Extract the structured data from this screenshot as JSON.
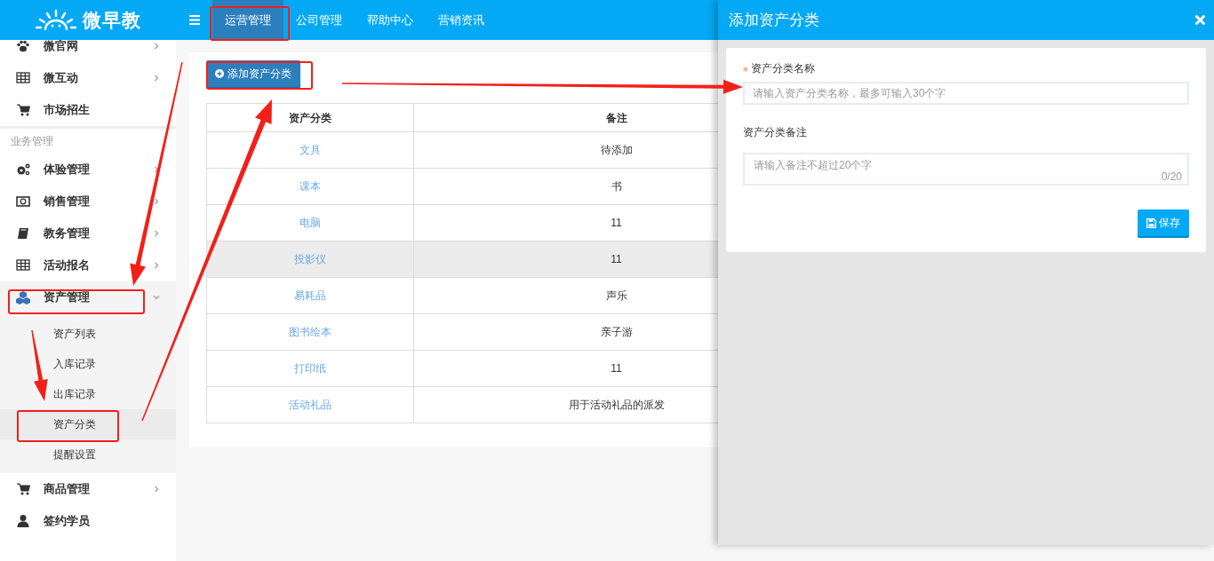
{
  "logo": {
    "text": "微早教"
  },
  "top_nav": [
    {
      "label": "运营管理",
      "selected": true
    },
    {
      "label": "公司管理",
      "selected": false
    },
    {
      "label": "帮助中心",
      "selected": false
    },
    {
      "label": "营销资讯",
      "selected": false
    }
  ],
  "sidebar": {
    "items": [
      {
        "kind": "item",
        "label": "微官网",
        "expanded": false
      },
      {
        "kind": "item",
        "label": "微互动",
        "expanded": false
      },
      {
        "kind": "item",
        "label": "市场招生"
      },
      {
        "kind": "heading",
        "label": "业务管理"
      },
      {
        "kind": "item",
        "label": "体验管理",
        "expanded": false
      },
      {
        "kind": "item",
        "label": "销售管理",
        "expanded": false
      },
      {
        "kind": "item",
        "label": "教务管理",
        "expanded": false
      },
      {
        "kind": "item",
        "label": "活动报名",
        "expanded": false
      },
      {
        "kind": "item",
        "label": "资产管理",
        "expanded": true,
        "children": [
          {
            "label": "资产列表",
            "selected": false
          },
          {
            "label": "入库记录",
            "selected": false
          },
          {
            "label": "出库记录",
            "selected": false
          },
          {
            "label": "资产分类",
            "selected": true
          },
          {
            "label": "提醒设置",
            "selected": false
          }
        ]
      },
      {
        "kind": "item",
        "label": "商品管理",
        "expanded": false
      },
      {
        "kind": "item",
        "label": "签约学员"
      }
    ]
  },
  "main": {
    "add_button": "添加资产分类",
    "table": {
      "columns": [
        "资产分类",
        "备注"
      ],
      "rows": [
        {
          "cells": [
            "文具",
            "待添加"
          ],
          "highlighted": false
        },
        {
          "cells": [
            "课本",
            "书"
          ],
          "highlighted": false
        },
        {
          "cells": [
            "电脑",
            "11"
          ],
          "highlighted": false
        },
        {
          "cells": [
            "投影仪",
            "11"
          ],
          "highlighted": true
        },
        {
          "cells": [
            "易耗品",
            "声乐"
          ],
          "highlighted": false
        },
        {
          "cells": [
            "图书绘本",
            "亲子游"
          ],
          "highlighted": false
        },
        {
          "cells": [
            "打印纸",
            "11"
          ],
          "highlighted": false
        },
        {
          "cells": [
            "活动礼品",
            "用于活动礼品的派发"
          ],
          "highlighted": false
        }
      ]
    }
  },
  "drawer": {
    "title": "添加资产分类",
    "fields": [
      {
        "kind": "input",
        "label": "资产分类名称",
        "required": true,
        "placeholder": "请输入资产分类名称，最多可输入30个字"
      },
      {
        "kind": "textarea",
        "label": "资产分类备注",
        "required": false,
        "placeholder": "请输入备注不超过20个字",
        "counter": "0/20"
      }
    ],
    "save_button": "保存"
  }
}
